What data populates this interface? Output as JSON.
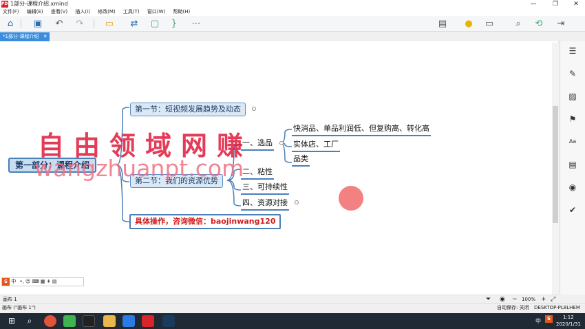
{
  "window": {
    "title": "1部分-课程介绍.xmind",
    "app_icon_text": "PDF",
    "minimize": "—",
    "maximize": "❐",
    "close": "✕"
  },
  "menu": [
    "文件(F)",
    "编辑(E)",
    "查看(V)",
    "插入(I)",
    "修改(M)",
    "工具(T)",
    "窗口(W)",
    "帮助(H)"
  ],
  "tab": {
    "label": "*1部分-课程介绍",
    "close": "✕"
  },
  "map": {
    "central": "第一部分：课程介绍",
    "node1": "第一节：短视频发展趋势及动态",
    "node2": "第二节：我们的资源优势",
    "node3": "具体操作，咨询微信：baojinwang120",
    "sub1": "一、选品",
    "sub2": "二、粘性",
    "sub3": "三、可持续性",
    "sub4": "四、资源对接",
    "leaf1": "快消品、单品利润低、但复购高、转化高",
    "leaf2": "实体店、工厂",
    "leaf3": "品类"
  },
  "watermark": {
    "line1": "自由领域网赚",
    "line2": "wangzhuanpt.com"
  },
  "ime": {
    "logo": "S",
    "mode": "中",
    "icons": "•, ☺ ⌨ ▦ ✈ ▤"
  },
  "bottom": {
    "sheet": "画布 1",
    "zoom": "100%",
    "zoom_minus": "−",
    "zoom_plus": "+"
  },
  "status": {
    "left": "画布 (\"画布 1\")",
    "autosave": "自动保存: 关闭",
    "computer": "DESKTOP-PL8LHEM"
  },
  "taskbar": {
    "time": "1:12",
    "date": "2020/1/31",
    "lang": "中",
    "ime": "S"
  }
}
